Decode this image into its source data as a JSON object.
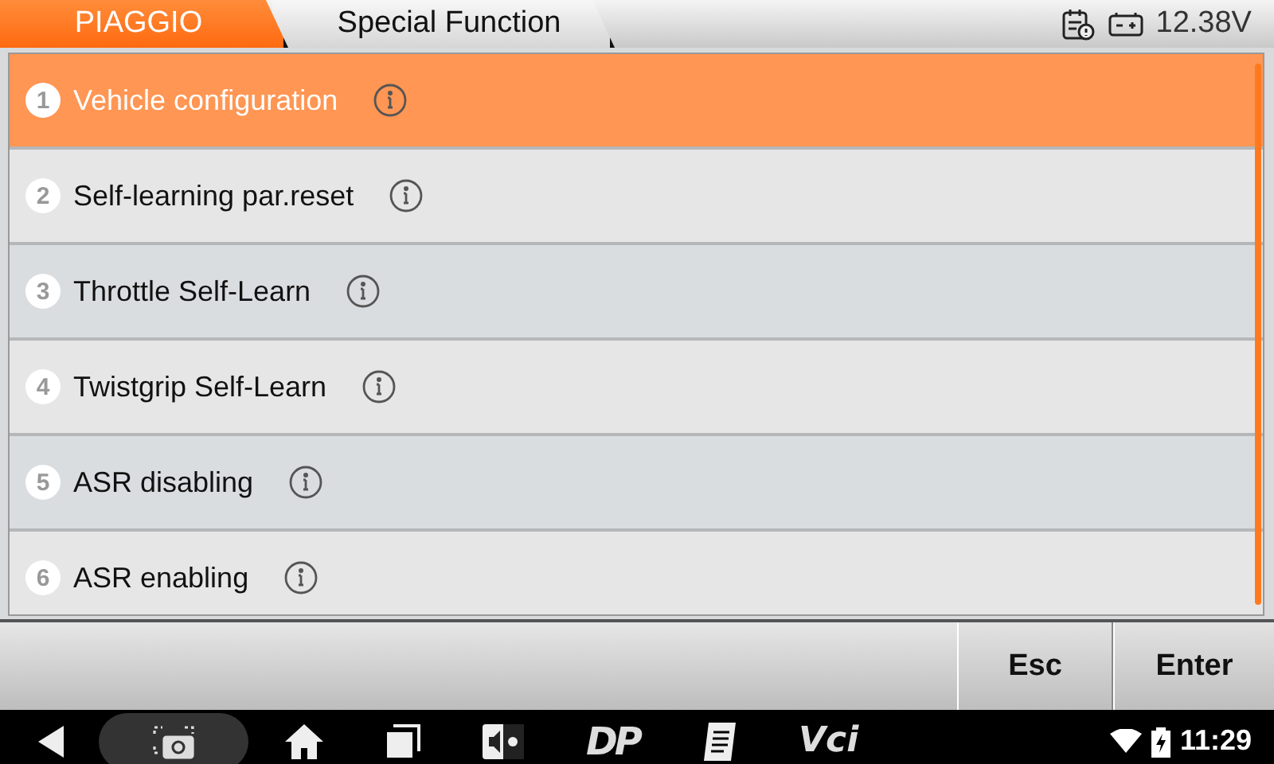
{
  "breadcrumb": [
    {
      "label": "PIAGGIO",
      "selected": true
    },
    {
      "label": "Special Function",
      "selected": false
    }
  ],
  "status": {
    "voltage": "12.38V"
  },
  "functions": [
    {
      "number": "1",
      "label": "Vehicle configuration",
      "selected": true
    },
    {
      "number": "2",
      "label": "Self-learning par.reset",
      "selected": false
    },
    {
      "number": "3",
      "label": "Throttle Self-Learn",
      "selected": false
    },
    {
      "number": "4",
      "label": "Twistgrip Self-Learn",
      "selected": false
    },
    {
      "number": "5",
      "label": "ASR disabling",
      "selected": false
    },
    {
      "number": "6",
      "label": "ASR enabling",
      "selected": false
    }
  ],
  "buttons": [
    "Esc",
    "Enter"
  ],
  "nav_bar": {
    "dp_label": "DP",
    "vci_label": "Vci",
    "time": "11:29"
  }
}
